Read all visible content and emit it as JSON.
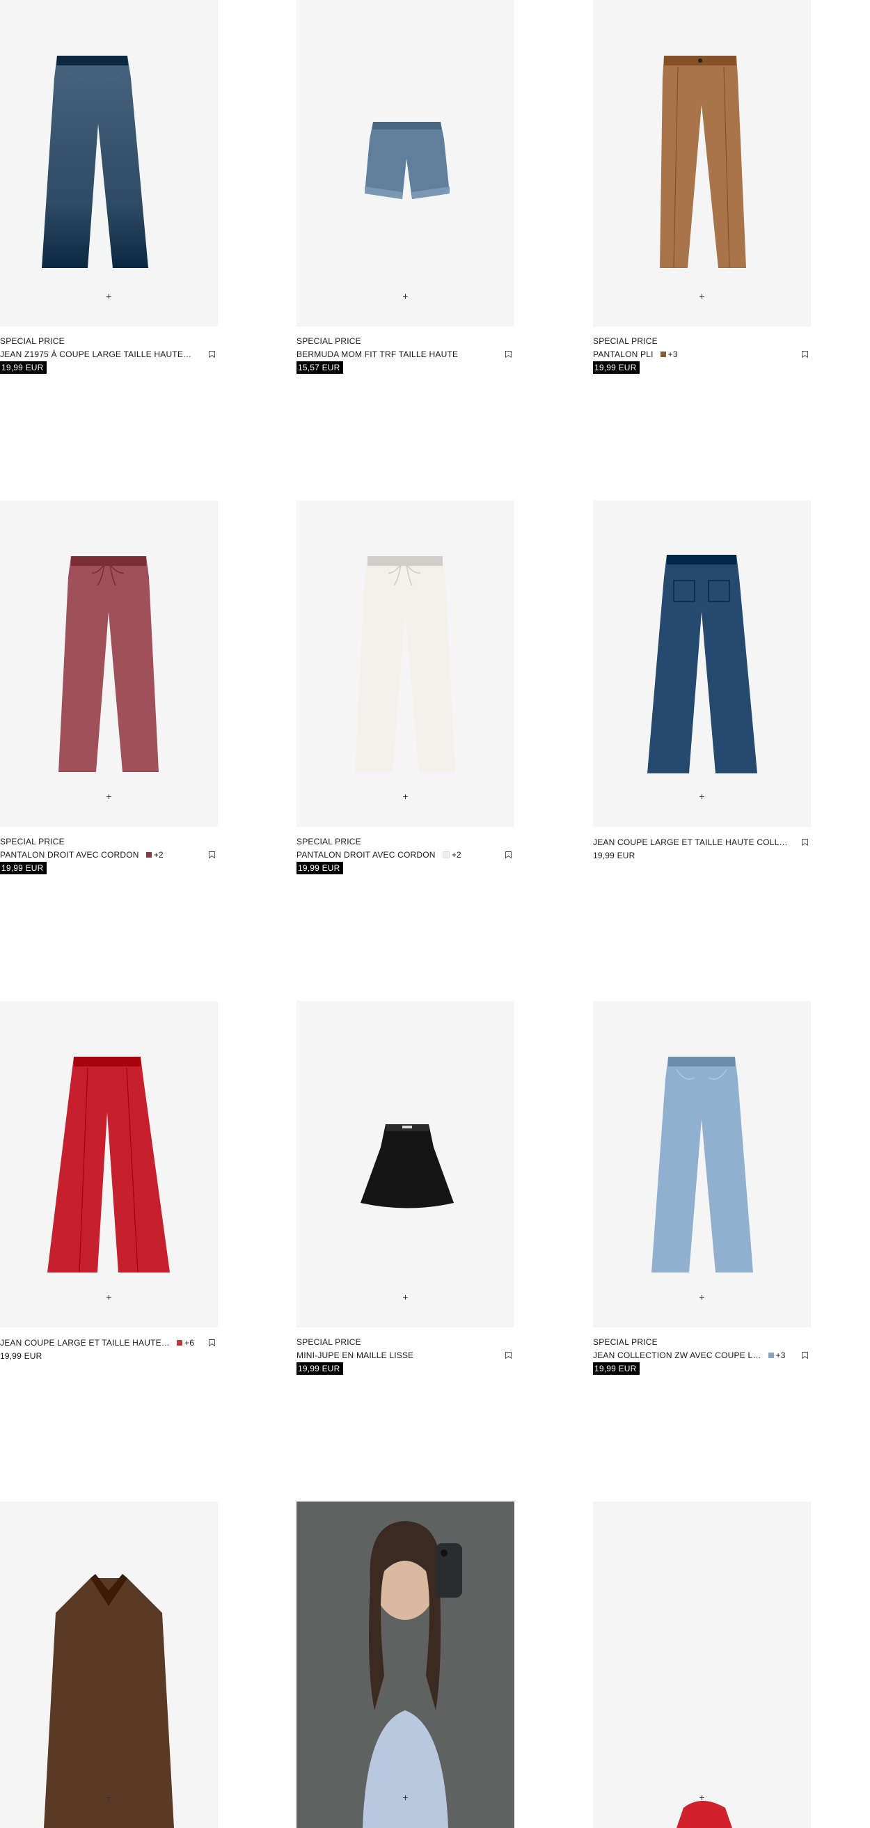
{
  "add_symbol": "+",
  "products": [
    {
      "badge": "SPECIAL PRICE",
      "name": "JEAN Z1975 À COUPE LARGE TAILLE HAUTE…",
      "price": "19,99 EUR",
      "price_highlight": true,
      "swatch_color": null,
      "more_colors": null,
      "garment": "wide-jeans",
      "garment_color": "#2f4b63"
    },
    {
      "badge": "SPECIAL PRICE",
      "name": "BERMUDA MOM FIT TRF TAILLE HAUTE",
      "price": "15,57 EUR",
      "price_highlight": true,
      "swatch_color": null,
      "more_colors": null,
      "garment": "shorts",
      "garment_color": "#5f7f9c"
    },
    {
      "badge": "SPECIAL PRICE",
      "name": "PANTALON PLI",
      "price": "19,99 EUR",
      "price_highlight": true,
      "swatch_color": "#8a5a3a",
      "more_colors": "+3",
      "garment": "pleated-trousers",
      "garment_color": "#a8744a"
    },
    {
      "badge": "SPECIAL PRICE",
      "name": "PANTALON DROIT AVEC CORDON",
      "price": "19,99 EUR",
      "price_highlight": true,
      "swatch_color": "#8c3b44",
      "more_colors": "+2",
      "garment": "drawstring-trousers",
      "garment_color": "#a0505a"
    },
    {
      "badge": "SPECIAL PRICE",
      "name": "PANTALON DROIT AVEC CORDON",
      "price": "19,99 EUR",
      "price_highlight": true,
      "swatch_color": "#f2efe6",
      "more_colors": "+2",
      "garment": "drawstring-trousers",
      "garment_color": "#f3f1ea"
    },
    {
      "badge": null,
      "name": "JEAN COUPE LARGE ET TAILLE HAUTE COLL…",
      "price": "19,99 EUR",
      "price_highlight": false,
      "swatch_color": null,
      "more_colors": null,
      "garment": "sailor-jeans",
      "garment_color": "#254a6e"
    },
    {
      "badge": null,
      "name": "JEAN COUPE LARGE ET TAILLE HAUTE…",
      "price": "19,99 EUR",
      "price_highlight": false,
      "swatch_color": "#b83a3a",
      "more_colors": "+6",
      "garment": "wide-trousers",
      "garment_color": "#c81f2e"
    },
    {
      "badge": "SPECIAL PRICE",
      "name": "MINI-JUPE EN MAILLE LISSE",
      "price": "19,99 EUR",
      "price_highlight": true,
      "swatch_color": null,
      "more_colors": null,
      "garment": "skirt",
      "garment_color": "#151515"
    },
    {
      "badge": "SPECIAL PRICE",
      "name": "JEAN COLLECTION ZW AVEC COUPE L…",
      "price": "19,99 EUR",
      "price_highlight": true,
      "swatch_color": "#8aa3bd",
      "more_colors": "+3",
      "garment": "light-jeans",
      "garment_color": "#8fb0cf"
    },
    {
      "badge": null,
      "name": null,
      "price": null,
      "price_highlight": false,
      "swatch_color": null,
      "more_colors": null,
      "garment": "jacket",
      "garment_color": "#5a3a26"
    },
    {
      "badge": null,
      "name": null,
      "price": null,
      "price_highlight": false,
      "swatch_color": null,
      "more_colors": null,
      "garment": "model-photo",
      "garment_color": "#b8c8de"
    },
    {
      "badge": null,
      "name": null,
      "price": null,
      "price_highlight": false,
      "swatch_color": null,
      "more_colors": null,
      "garment": "red-item",
      "garment_color": "#d0202c"
    }
  ]
}
